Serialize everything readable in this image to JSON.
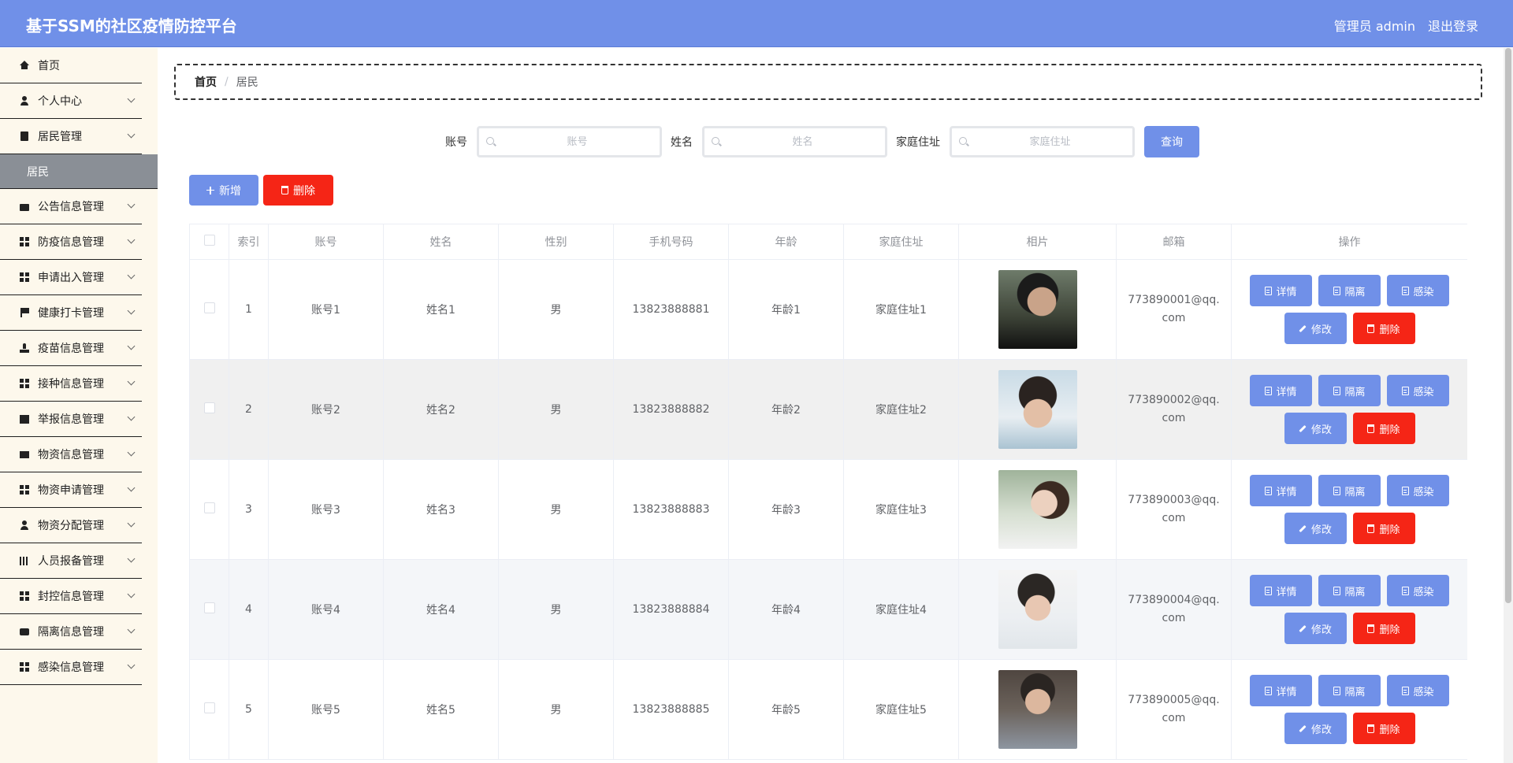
{
  "header": {
    "title": "基于SSM的社区疫情防控平台",
    "user": "管理员 admin",
    "logout": "退出登录"
  },
  "sidebar": {
    "items": [
      {
        "label": "首页",
        "icon": "home-icon"
      },
      {
        "label": "个人中心",
        "icon": "user-icon"
      },
      {
        "label": "居民管理",
        "icon": "clipboard-icon"
      },
      {
        "label": "公告信息管理",
        "icon": "briefcase-icon"
      },
      {
        "label": "防疫信息管理",
        "icon": "grid-icon"
      },
      {
        "label": "申请出入管理",
        "icon": "grid-icon"
      },
      {
        "label": "健康打卡管理",
        "icon": "flag-icon"
      },
      {
        "label": "疫苗信息管理",
        "icon": "stamp-icon"
      },
      {
        "label": "接种信息管理",
        "icon": "grid-icon"
      },
      {
        "label": "举报信息管理",
        "icon": "chart-icon"
      },
      {
        "label": "物资信息管理",
        "icon": "monitor-icon"
      },
      {
        "label": "物资申请管理",
        "icon": "grid-icon"
      },
      {
        "label": "物资分配管理",
        "icon": "user-icon"
      },
      {
        "label": "人员报备管理",
        "icon": "bars-icon"
      },
      {
        "label": "封控信息管理",
        "icon": "grid-icon"
      },
      {
        "label": "隔离信息管理",
        "icon": "chat-icon"
      },
      {
        "label": "感染信息管理",
        "icon": "grid-icon"
      }
    ],
    "submenu": {
      "label": "居民"
    }
  },
  "breadcrumb": {
    "home": "首页",
    "sep": "/",
    "current": "居民"
  },
  "search": {
    "account_label": "账号",
    "account_placeholder": "账号",
    "name_label": "姓名",
    "name_placeholder": "姓名",
    "address_label": "家庭住址",
    "address_placeholder": "家庭住址",
    "query_button": "查询"
  },
  "actions": {
    "add": "新增",
    "delete": "删除"
  },
  "table": {
    "columns": [
      "",
      "索引",
      "账号",
      "姓名",
      "性别",
      "手机号码",
      "年龄",
      "家庭住址",
      "相片",
      "邮箱",
      "操作"
    ],
    "rows": [
      {
        "index": "1",
        "account": "账号1",
        "name": "姓名1",
        "gender": "男",
        "phone": "13823888881",
        "age": "年龄1",
        "address": "家庭住址1",
        "email": "773890001@qq.com"
      },
      {
        "index": "2",
        "account": "账号2",
        "name": "姓名2",
        "gender": "男",
        "phone": "13823888882",
        "age": "年龄2",
        "address": "家庭住址2",
        "email": "773890002@qq.com"
      },
      {
        "index": "3",
        "account": "账号3",
        "name": "姓名3",
        "gender": "男",
        "phone": "13823888883",
        "age": "年龄3",
        "address": "家庭住址3",
        "email": "773890003@qq.com"
      },
      {
        "index": "4",
        "account": "账号4",
        "name": "姓名4",
        "gender": "男",
        "phone": "13823888884",
        "age": "年龄4",
        "address": "家庭住址4",
        "email": "773890004@qq.com"
      },
      {
        "index": "5",
        "account": "账号5",
        "name": "姓名5",
        "gender": "男",
        "phone": "13823888885",
        "age": "年龄5",
        "address": "家庭住址5",
        "email": "773890005@qq.com"
      }
    ],
    "row_ops": {
      "detail": "详情",
      "isolate": "隔离",
      "infect": "感染",
      "edit": "修改",
      "delete": "删除"
    }
  },
  "colors": {
    "primary": "#7090e8",
    "danger": "#f52516",
    "sidebar_bg": "#fdf8ec",
    "submenu_bg": "#8a8f96"
  }
}
